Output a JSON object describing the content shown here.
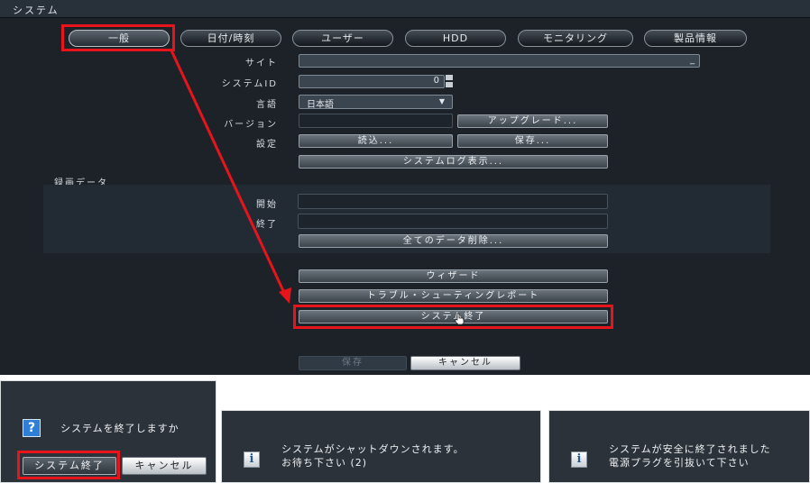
{
  "panel": {
    "title": "システム"
  },
  "tabs": [
    {
      "label": "一般",
      "active": true
    },
    {
      "label": "日付/時刻"
    },
    {
      "label": "ユーザー"
    },
    {
      "label": "HDD"
    },
    {
      "label": "モニタリング"
    },
    {
      "label": "製品情報"
    }
  ],
  "form": {
    "site_label": "サイト",
    "system_id_label": "システムID",
    "system_id_value": "0",
    "language_label": "言語",
    "language_value": "日本語",
    "version_label": "バージョン",
    "upgrade_button": "アップグレード...",
    "settings_label": "設定",
    "load_button": "読込...",
    "save_button": "保存...",
    "syslog_button": "システムログ表示..."
  },
  "record_data": {
    "section_label": "録画データ",
    "start_label": "開始",
    "end_label": "終了",
    "delete_all_button": "全てのデータ削除..."
  },
  "actions": {
    "wizard_button": "ウィザード",
    "troubleshoot_button": "トラブル・シューティングレポート",
    "shutdown_button": "システム終了"
  },
  "footer": {
    "save_button": "保存",
    "cancel_button": "キャンセル"
  },
  "dialogs": {
    "confirm": {
      "question": "システムを終了しますか",
      "shutdown_button": "システム終了",
      "cancel_button": "キャンセル",
      "icon": "question-icon"
    },
    "progress": {
      "line1": "システムがシャットダウンされます。",
      "line2": "お待ち下さい (2)",
      "icon": "info-icon"
    },
    "done": {
      "line1": "システムが安全に終了されました",
      "line2": "電源プラグを引抜いて下さい",
      "icon": "info-icon"
    }
  },
  "colors": {
    "highlight": "#e8141c",
    "accent_blue": "#2f7fd6",
    "panel_bg": "#1c2228"
  }
}
